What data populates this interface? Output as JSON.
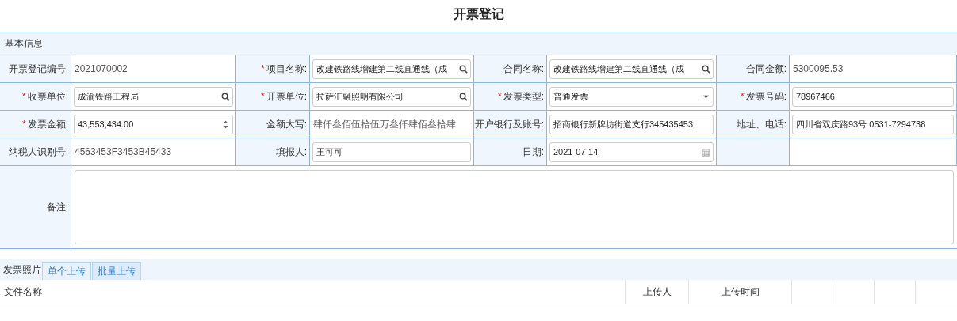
{
  "title": "开票登记",
  "section": "基本信息",
  "fields": [
    {
      "label": "开票登记编号:",
      "kind": "readonly",
      "value": "2021070002"
    },
    {
      "label": "项目名称:",
      "required_mark": "*",
      "kind": "lookup",
      "value": "改建铁路线增建第二线直通线（成"
    },
    {
      "label": "合同名称:",
      "kind": "lookup",
      "value": "改建铁路线增建第二线直通线（成"
    },
    {
      "label": "合同金额:",
      "kind": "readonly",
      "value": "5300095.53"
    },
    {
      "label": "收票单位:",
      "required_mark": "*",
      "kind": "lookup",
      "value": "成渝铁路工程局"
    },
    {
      "label": "开票单位:",
      "required_mark": "*",
      "kind": "lookup",
      "value": "拉萨汇融照明有限公司"
    },
    {
      "label": "发票类型:",
      "required_mark": "*",
      "kind": "select",
      "value": "普通发票"
    },
    {
      "label": "发票号码:",
      "required_mark": "*",
      "kind": "input",
      "value": "78967466"
    },
    {
      "label": "发票金额:",
      "required_mark": "*",
      "kind": "number",
      "value": "43,553,434.00"
    },
    {
      "label": "金额大写:",
      "kind": "readonly",
      "value": "肆仟叁佰伍拾伍万叁仟肆佰叁拾肆"
    },
    {
      "label": "开户银行及账号:",
      "kind": "input",
      "value": "招商银行新牌坊街道支行345435453"
    },
    {
      "label": "地址、电话:",
      "kind": "input",
      "value": "四川省双庆路93号 0531-7294738"
    },
    {
      "label": "纳税人识别号:",
      "kind": "readonly",
      "value": "4563453F3453B45433"
    },
    {
      "label": "填报人:",
      "kind": "input",
      "value": "王可可"
    },
    {
      "label": "日期:",
      "kind": "date",
      "value": "2021-07-14"
    },
    {
      "kind": "empty"
    }
  ],
  "remark": {
    "label": "备注:"
  },
  "attachments": {
    "label": "发票照片",
    "tabs": [
      {
        "label": "单个上传",
        "selected": true
      },
      {
        "label": "批量上传",
        "selected": false
      }
    ],
    "columns": [
      "文件名称",
      "上传人",
      "上传时间"
    ]
  }
}
